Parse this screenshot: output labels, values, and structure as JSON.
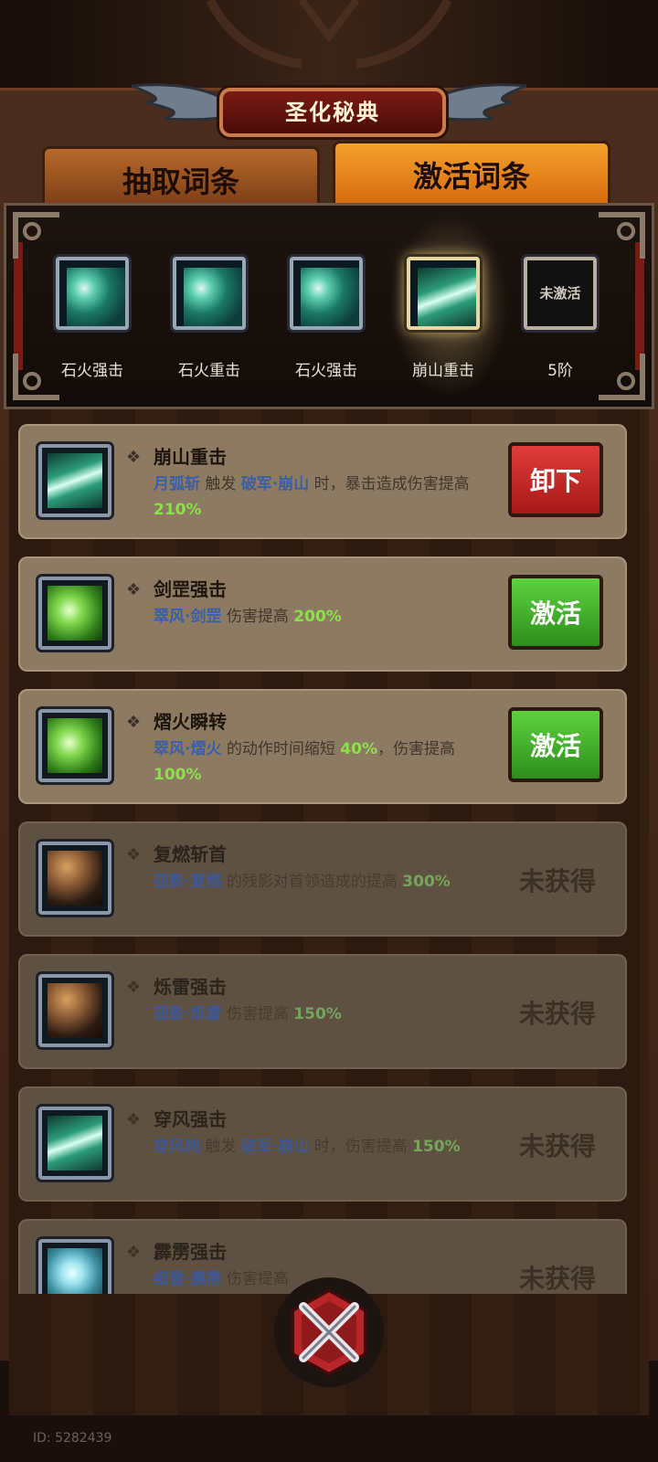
{
  "header": {
    "title": "圣化秘典"
  },
  "tabs": [
    {
      "label": "抽取词条",
      "active": false
    },
    {
      "label": "激活词条",
      "active": true
    }
  ],
  "slots": [
    {
      "name": "石火强击",
      "icon": "teal-slash-icon",
      "active": false
    },
    {
      "name": "石火重击",
      "icon": "teal-slash-icon",
      "active": false
    },
    {
      "name": "石火强击",
      "icon": "teal-slash-icon",
      "active": false
    },
    {
      "name": "崩山重击",
      "icon": "spear-icon",
      "active": true
    },
    {
      "name": "5阶",
      "empty_label": "未激活",
      "icon": "empty-slot",
      "active": false
    }
  ],
  "entries": [
    {
      "name": "崩山重击",
      "icon": "spear-icon",
      "art": "spear",
      "desc": [
        {
          "t": "月弧斩",
          "k": "kw"
        },
        {
          "t": " 触发 "
        },
        {
          "t": "破军·崩山",
          "k": "kw"
        },
        {
          "t": " 时，暴击造成伤害提高 "
        },
        {
          "t": "210%",
          "k": "pct"
        }
      ],
      "action": "卸下",
      "action_style": "red",
      "locked": false
    },
    {
      "name": "剑罡强击",
      "icon": "green-swirl-icon",
      "art": "green",
      "desc": [
        {
          "t": "翠风·剑罡",
          "k": "kw"
        },
        {
          "t": " 伤害提高 "
        },
        {
          "t": "200%",
          "k": "pct"
        }
      ],
      "action": "激活",
      "action_style": "green",
      "locked": false
    },
    {
      "name": "熠火瞬转",
      "icon": "green-swirl-icon",
      "art": "green",
      "desc": [
        {
          "t": "翠风·熠火",
          "k": "kw"
        },
        {
          "t": " 的动作时间缩短 "
        },
        {
          "t": "40%",
          "k": "pct"
        },
        {
          "t": "，伤害提高 "
        },
        {
          "t": "100%",
          "k": "pct"
        }
      ],
      "action": "激活",
      "action_style": "green",
      "locked": false
    },
    {
      "name": "复燃斩首",
      "icon": "straw-hat-icon",
      "art": "hat",
      "desc": [
        {
          "t": "孤影·复燃",
          "k": "kw"
        },
        {
          "t": " 的残影对首领造成的提高 "
        },
        {
          "t": "300%",
          "k": "pct"
        }
      ],
      "status": "未获得",
      "locked": true
    },
    {
      "name": "烁雷强击",
      "icon": "straw-hat-icon",
      "art": "hat",
      "desc": [
        {
          "t": "孤影·烁雷",
          "k": "kw"
        },
        {
          "t": " 伤害提高 "
        },
        {
          "t": "150%",
          "k": "pct"
        }
      ],
      "status": "未获得",
      "locked": true
    },
    {
      "name": "穿风强击",
      "icon": "spear-icon",
      "art": "spear",
      "desc": [
        {
          "t": "穿风刺",
          "k": "kw"
        },
        {
          "t": " 触发 "
        },
        {
          "t": "破军·崩山",
          "k": "kw"
        },
        {
          "t": " 时，伤害提高 "
        },
        {
          "t": "150%",
          "k": "pct"
        }
      ],
      "status": "未获得",
      "locked": true
    },
    {
      "name": "霹雳强击",
      "icon": "ice-burst-icon",
      "art": "ice",
      "desc": [
        {
          "t": "细雪·霹雳",
          "k": "kw"
        },
        {
          "t": " 伤害提高"
        }
      ],
      "status": "未获得",
      "locked": true
    }
  ],
  "footer": {
    "uid": "ID: 5282439",
    "close_icon": "close-x-icon"
  },
  "colors": {
    "accent_orange": "#f5a12c",
    "unequip_red": "#c82828",
    "activate_green": "#3fae2a",
    "keyword_blue": "#3b5ea8",
    "percent_green": "#8ce04a"
  }
}
